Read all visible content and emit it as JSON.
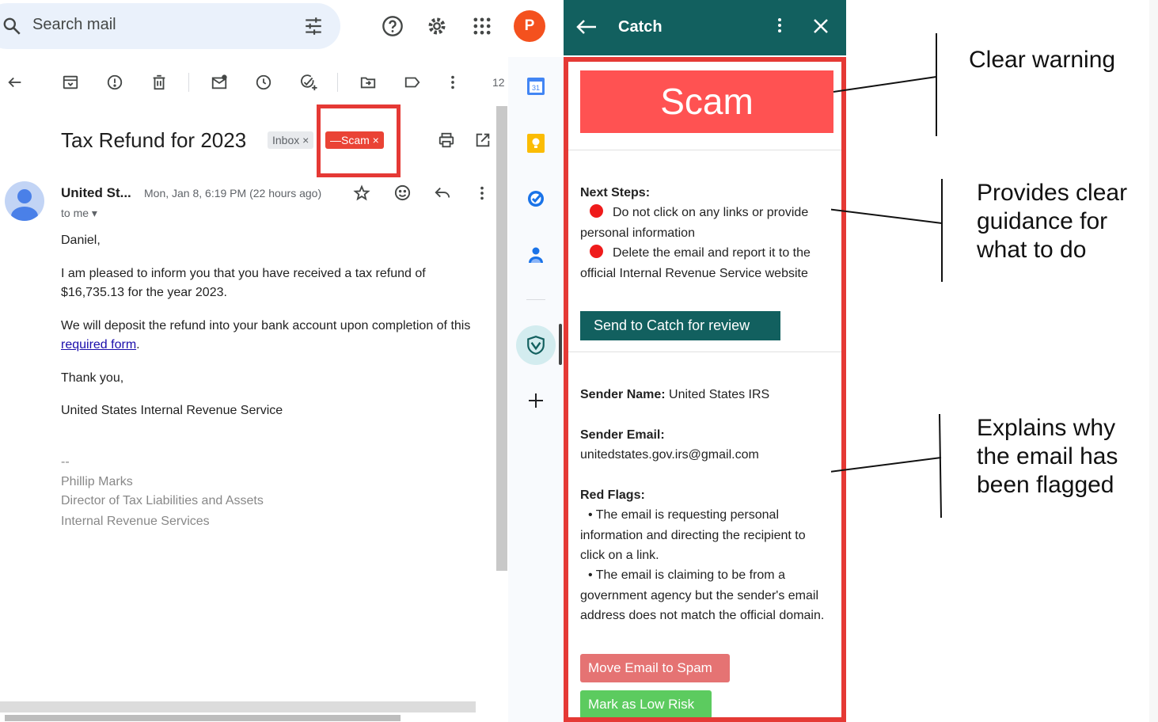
{
  "search": {
    "placeholder": "Search mail"
  },
  "account": {
    "initial": "P"
  },
  "toolbar": {
    "count": "12"
  },
  "email": {
    "subject": "Tax Refund for 2023",
    "labels": {
      "inbox": "Inbox ×",
      "scam": "—Scam ×"
    },
    "sender_name": "United St...",
    "date": "Mon, Jan 8, 6:19 PM (22 hours ago)",
    "to": "to me ▾",
    "greeting": "Daniel,",
    "para1": "I am pleased to inform you that you have received a tax refund of $16,735.13 for the year 2023.",
    "para2_before": "We will deposit the refund into your bank account upon completion of this ",
    "para2_link": "required form",
    "para2_after": ".",
    "thanks": "Thank you,",
    "from_org": "United States Internal Revenue Service",
    "sig_dash": "--",
    "sig_name": "Phillip Marks",
    "sig_title": "Director of Tax Liabilities and Assets",
    "sig_org": "Internal Revenue Services"
  },
  "rail": {
    "calendar_day": "31"
  },
  "catch": {
    "title": "Catch",
    "verdict": "Scam",
    "next_steps_label": "Next Steps:",
    "step1": "Do not click on any links or provide personal information",
    "step2": "Delete the email and report it to the official Internal Revenue Service website",
    "send_button": "Send to Catch for review",
    "sender_name_label": "Sender Name:",
    "sender_name_value": " United States IRS",
    "sender_email_label": "Sender Email:",
    "sender_email_value": "unitedstates.gov.irs@gmail.com",
    "red_flags_label": "Red Flags:",
    "flag1": "• The email is requesting personal information and directing the recipient to click on a link.",
    "flag2": "• The email is claiming to be from a government agency but the sender's email address does not match the official domain.",
    "spam_button": "Move Email to Spam",
    "low_risk_button": "Mark as Low Risk",
    "colors": {
      "header": "#12605f",
      "banner": "#ff5252",
      "highlight": "#e53935"
    }
  },
  "annotations": {
    "a1": "Clear warning",
    "a2": "Provides clear guidance for what to do",
    "a3": "Explains why the email has been flagged"
  }
}
